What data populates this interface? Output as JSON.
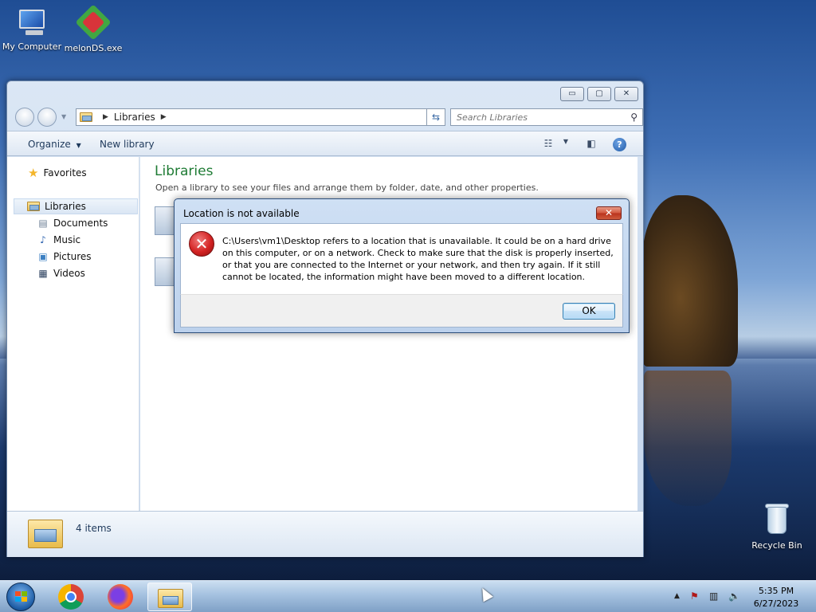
{
  "desktop": {
    "icons": [
      {
        "label": "My Computer",
        "icon": "computer-icon"
      },
      {
        "label": "melonDS.exe",
        "icon": "melonds-icon"
      },
      {
        "label": "Recycle Bin",
        "icon": "recycle-bin-icon"
      }
    ]
  },
  "explorer": {
    "caption": {
      "minimize": "▭",
      "maximize": "▢",
      "close": "✕"
    },
    "address": {
      "path": [
        "Libraries"
      ],
      "dropdown_glyph": "▼",
      "refresh_glyph": "⇆"
    },
    "search": {
      "placeholder": "Search Libraries",
      "icon": "search-icon"
    },
    "toolbar": {
      "organize": "Organize",
      "organize_arrow": "▼",
      "new_library": "New library",
      "views_arrow": "▼"
    },
    "nav": {
      "favorites": "Favorites",
      "libraries": "Libraries",
      "items": [
        {
          "label": "Documents",
          "icon": "documents-icon"
        },
        {
          "label": "Music",
          "icon": "music-icon"
        },
        {
          "label": "Pictures",
          "icon": "pictures-icon"
        },
        {
          "label": "Videos",
          "icon": "videos-icon"
        }
      ]
    },
    "content": {
      "title": "Libraries",
      "subtitle": "Open a library to see your files and arrange them by folder, date, and other properties."
    },
    "details": {
      "count": "4 items"
    }
  },
  "dialog": {
    "title": "Location is not available",
    "close_glyph": "✕",
    "error_glyph": "✕",
    "message": "C:\\Users\\vm1\\Desktop refers to a location that is unavailable. It could be on a hard drive on this computer, or on a network. Check to make sure that the disk is properly inserted, or that you are connected to the Internet or your network, and then try again. If it still cannot be located, the information might have been moved to a different location.",
    "ok_label": "OK"
  },
  "taskbar": {
    "apps": [
      "Chrome",
      "Firefox",
      "Windows Explorer"
    ],
    "tray": {
      "expand": "▲"
    },
    "time": "5:35 PM",
    "date": "6/27/2023"
  },
  "colors": {
    "title_green": "#1e7b34",
    "accent_blue": "#3c7fb1",
    "error_red": "#d42323"
  }
}
